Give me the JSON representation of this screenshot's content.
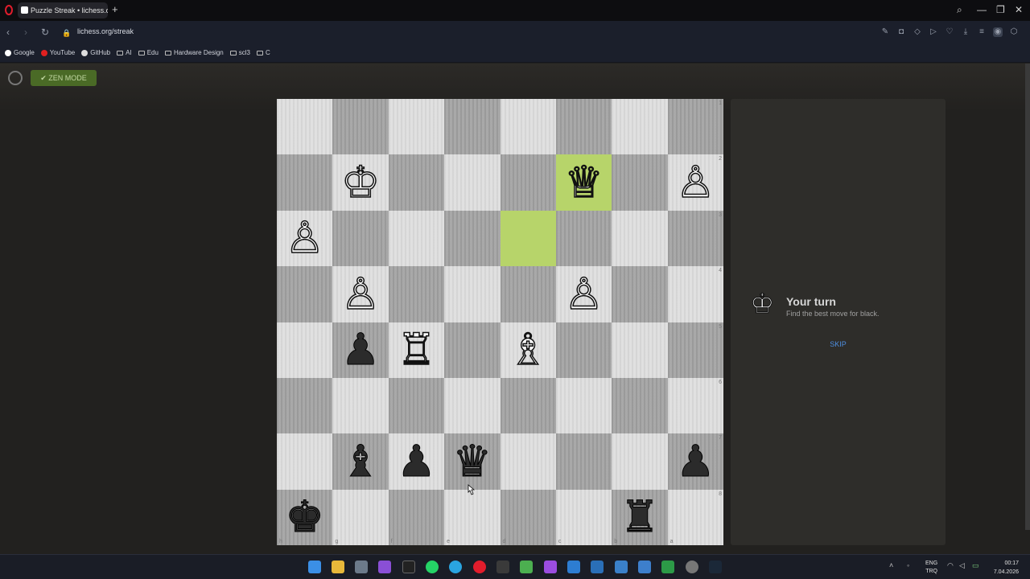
{
  "browser": {
    "tab_title": "Puzzle Streak • lichess.org",
    "new_tab": "+",
    "url": "lichess.org/streak",
    "window_controls": [
      "⌕",
      "—",
      "❐",
      "✕"
    ],
    "bookmarks": [
      "Google",
      "YouTube",
      "GitHub",
      "AI",
      "Edu",
      "Hardware Design",
      "scl3",
      "C"
    ]
  },
  "page": {
    "zen_mode_label": "✔ ZEN MODE",
    "board": {
      "orientation": "black",
      "rank_labels": [
        "1",
        "2",
        "3",
        "4",
        "5",
        "6",
        "7",
        "8"
      ],
      "file_labels": [
        "h",
        "g",
        "f",
        "e",
        "d",
        "c",
        "b",
        "a"
      ],
      "last_move_squares": [
        "c2",
        "d3"
      ],
      "rows": [
        [
          "",
          "",
          "",
          "",
          "",
          "",
          "",
          ""
        ],
        [
          "",
          "♔",
          "",
          "",
          "",
          "♕",
          "",
          "♙"
        ],
        [
          "♙",
          "",
          "",
          "",
          "",
          "",
          "",
          ""
        ],
        [
          "",
          "♙",
          "",
          "",
          "",
          "♙",
          "",
          ""
        ],
        [
          "",
          "♟",
          "♖",
          "",
          "♗",
          "",
          "",
          ""
        ],
        [
          "",
          "",
          "",
          "",
          "",
          "",
          "",
          ""
        ],
        [
          "",
          "♝",
          "♟",
          "♛",
          "",
          "",
          "",
          "♟"
        ],
        [
          "♚",
          "",
          "",
          "",
          "",
          "",
          "♜",
          ""
        ]
      ]
    },
    "puzzle_panel": {
      "turn_icon": "♔",
      "title": "Your turn",
      "subtitle": "Find the best move for black.",
      "skip_label": "SKIP"
    }
  },
  "taskbar": {
    "language": "ENG",
    "layout": "TRQ",
    "time": "00:17",
    "date": "7.04.2026"
  }
}
